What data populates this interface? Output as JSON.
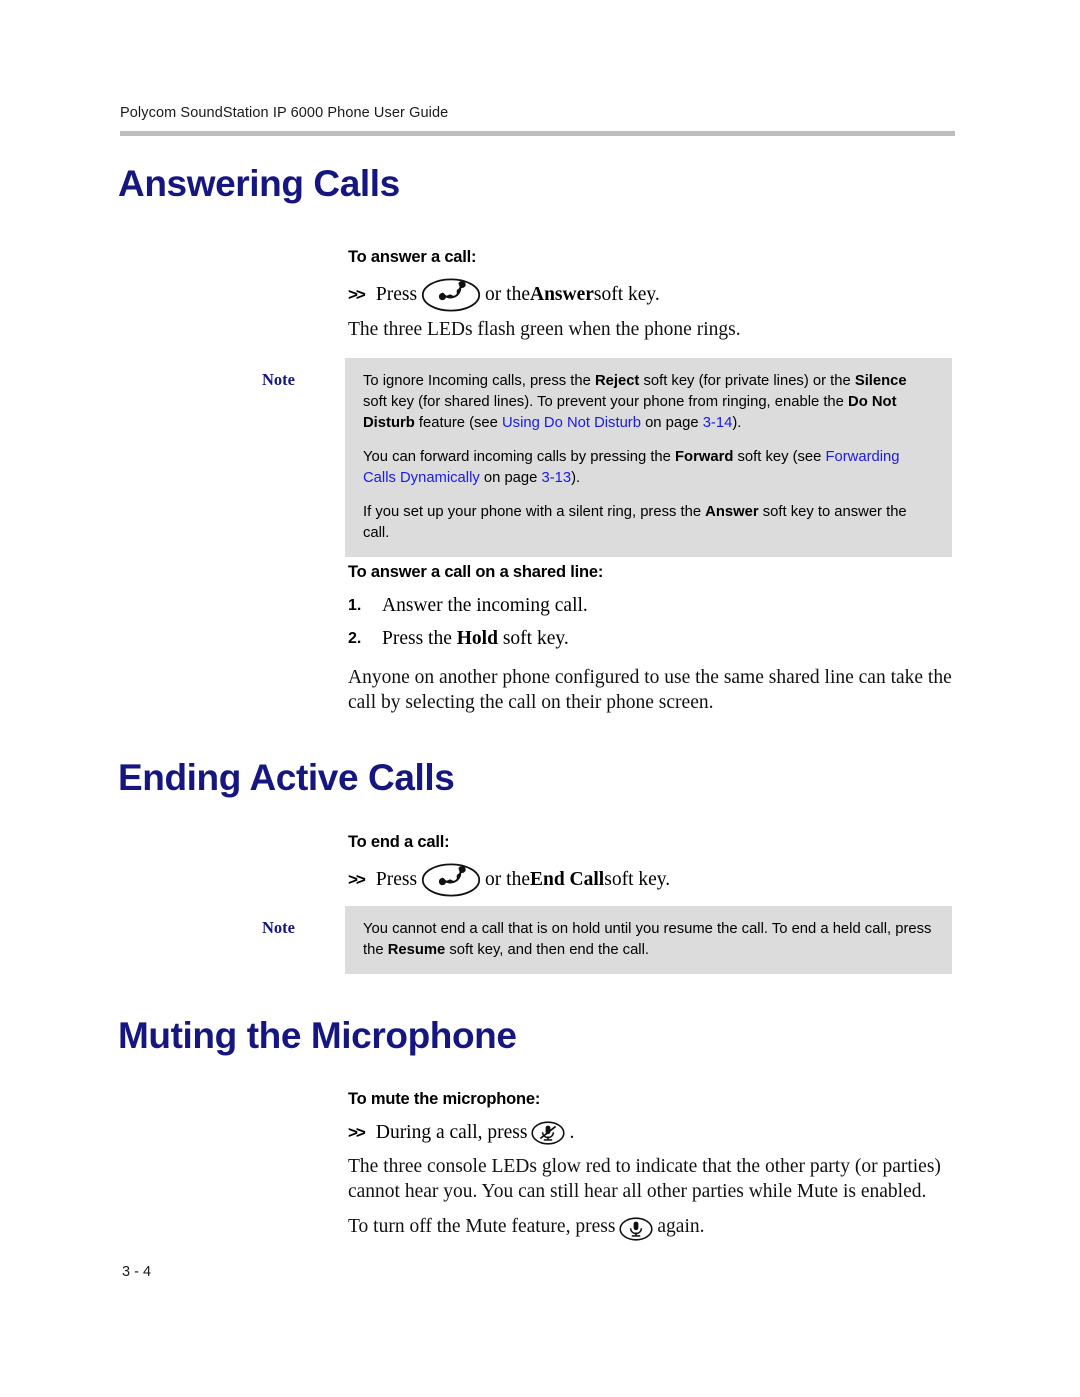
{
  "page": {
    "running_header": "Polycom SoundStation IP 6000 Phone User Guide",
    "folio": "3 - 4",
    "accent_heading_color": "#161680",
    "link_color": "#1a1ae6",
    "note_background_color": "#dcdcdc",
    "rule_color": "#bdbdbd"
  },
  "sections": {
    "answering": {
      "heading": "Answering Calls",
      "proc1_title": "To answer a call:",
      "proc1_step_arrows": ">>",
      "proc1_step_pre": "Press",
      "proc1_icon": "phone-handset-icon",
      "proc1_step_post_plain_1": "or the ",
      "proc1_step_post_bold": "Answer",
      "proc1_step_post_plain_2": " soft key.",
      "proc1_followup": "The three LEDs flash green when the phone rings.",
      "note_label": "Note",
      "note_p1": {
        "t1": "To ignore Incoming calls, press the ",
        "b1": "Reject",
        "t2": " soft key (for private lines) or the ",
        "b2": "Silence",
        "t3": " soft key (for shared lines). To prevent your phone from ringing, enable the ",
        "b3": "Do Not Disturb",
        "t4": " feature (see ",
        "link1": "Using Do Not Disturb",
        "t5": " on page ",
        "link2": "3-14",
        "t6": ")."
      },
      "note_p2": {
        "t1": "You can forward incoming calls by pressing the ",
        "b1": "Forward",
        "t2": " soft key (see ",
        "link1": "Forwarding Calls Dynamically",
        "t3": " on page ",
        "link2": "3-13",
        "t4": ")."
      },
      "note_p3": {
        "t1": "If you set up your phone with a silent ring, press the ",
        "b1": "Answer",
        "t2": " soft key to answer the call."
      },
      "proc2_title": "To answer a call on a shared line:",
      "proc2_steps": [
        {
          "num": "1.",
          "text": "Answer the incoming call."
        },
        {
          "num": "2.",
          "pre": "Press the ",
          "bold": "Hold",
          "post": " soft key."
        }
      ],
      "proc2_followup": "Anyone on another phone configured to use the same shared line can take the call by selecting the call on their phone screen."
    },
    "ending": {
      "heading": "Ending Active Calls",
      "proc_title": "To end a call:",
      "step_arrows": ">>",
      "step_pre": "Press",
      "step_icon": "phone-handset-icon",
      "step_post_plain_1": "or the ",
      "step_post_bold": "End Call",
      "step_post_plain_2": " soft key.",
      "note_label": "Note",
      "note_p1": {
        "t1": "You cannot end a call that is on hold until you resume the call. To end a held call, press the ",
        "b1": "Resume",
        "t2": " soft key, and then end the call."
      }
    },
    "muting": {
      "heading": "Muting the Microphone",
      "proc_title": "To mute the microphone:",
      "step_arrows": ">>",
      "step_pre": "During a call, press",
      "step_icon": "microphone-mute-icon",
      "step_post": ".",
      "para1": "The three console LEDs glow red to indicate that the other party (or parties) cannot hear you. You can still hear all other parties while Mute is enabled.",
      "para2_pre": "To turn off the Mute feature, press",
      "para2_icon": "microphone-icon",
      "para2_post": "again."
    }
  }
}
